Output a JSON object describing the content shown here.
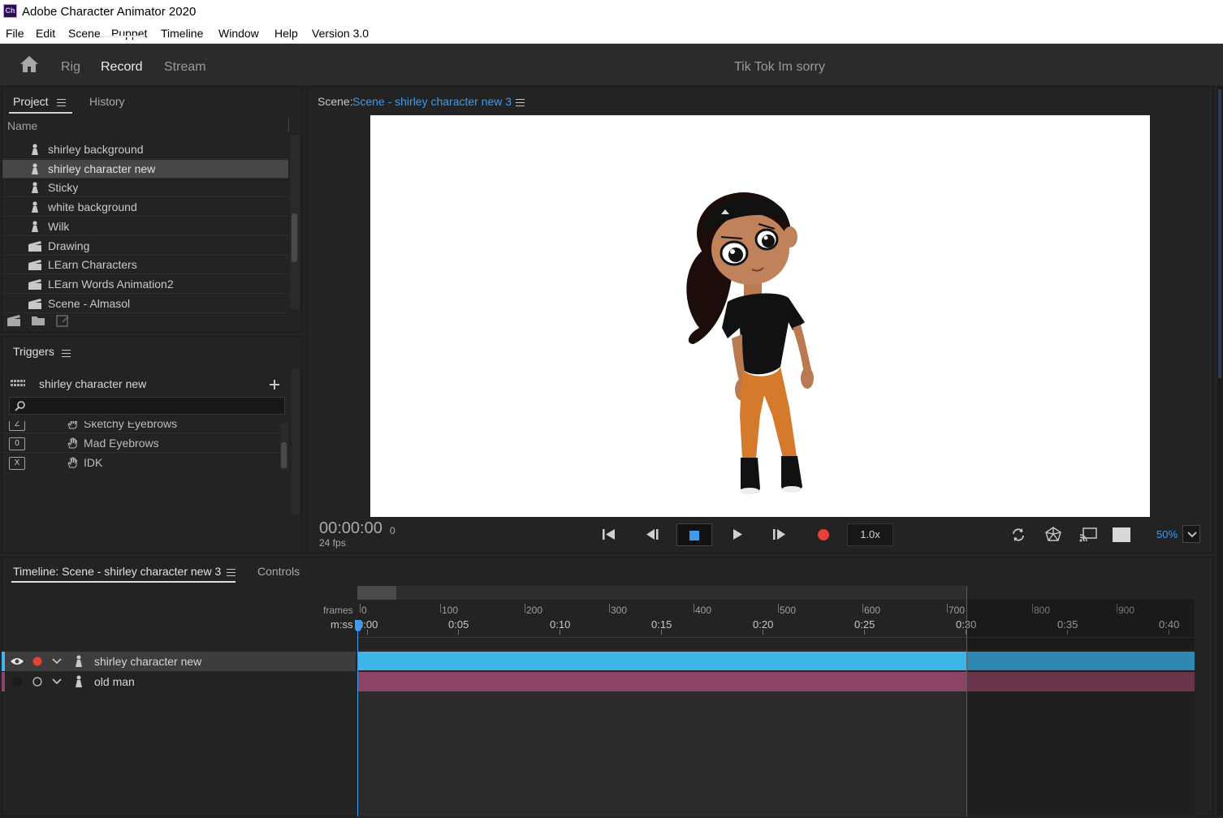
{
  "window": {
    "title": "Adobe Character Animator 2020",
    "logo": "Ch"
  },
  "menu": [
    "File",
    "Edit",
    "Scene",
    "Puppet",
    "Timeline",
    "Window",
    "Help",
    "Version 3.0"
  ],
  "workspace": {
    "tabs": [
      "Rig",
      "Record",
      "Stream"
    ],
    "active": "Record",
    "project_title": "Tik Tok Im sorry"
  },
  "project_panel": {
    "tabs": [
      "Project",
      "History"
    ],
    "column_header": "Name",
    "items": [
      {
        "label": "shirley background",
        "type": "puppet"
      },
      {
        "label": "shirley character new",
        "type": "puppet",
        "selected": true
      },
      {
        "label": "Sticky",
        "type": "puppet"
      },
      {
        "label": "white background",
        "type": "puppet"
      },
      {
        "label": "Wilk",
        "type": "puppet"
      },
      {
        "label": "Drawing",
        "type": "scene"
      },
      {
        "label": "LEarn Characters",
        "type": "scene"
      },
      {
        "label": "LEarn Words Animation2",
        "type": "scene"
      },
      {
        "label": "Scene - Almasol",
        "type": "scene"
      }
    ]
  },
  "triggers_panel": {
    "title": "Triggers",
    "puppet": "shirley character new",
    "search_placeholder": "",
    "items": [
      {
        "key": "Z",
        "label": "Sketchy Eyebrows"
      },
      {
        "key": "0",
        "label": "Mad Eyebrows"
      },
      {
        "key": "X",
        "label": "IDK"
      }
    ]
  },
  "scene_panel": {
    "label": "Scene:",
    "scene_name": "Scene - shirley character new 3",
    "timecode": "00:00:00",
    "frame": "0",
    "fps": "24 fps",
    "speed": "1.0x",
    "zoom": "50%"
  },
  "timeline_panel": {
    "tabs": [
      "Timeline: Scene - shirley character new 3",
      "Controls"
    ],
    "frames_label": "frames",
    "mss_label": "m:ss",
    "frame_ticks": [
      "0",
      "100",
      "200",
      "300",
      "400",
      "500",
      "600",
      "700",
      "800",
      "900"
    ],
    "time_ticks": [
      "0:00",
      "0:05",
      "0:10",
      "0:15",
      "0:20",
      "0:25",
      "0:30",
      "0:35",
      "0:40"
    ],
    "layers": [
      {
        "name": "shirley character new",
        "color": "#3fb6ea",
        "selected": true
      },
      {
        "name": "old man",
        "color": "#8c4466"
      }
    ]
  },
  "colors": {
    "accent": "#3b9cf0",
    "record": "#e5403a",
    "track1": "#3fb6ea",
    "track2": "#8c4466"
  }
}
